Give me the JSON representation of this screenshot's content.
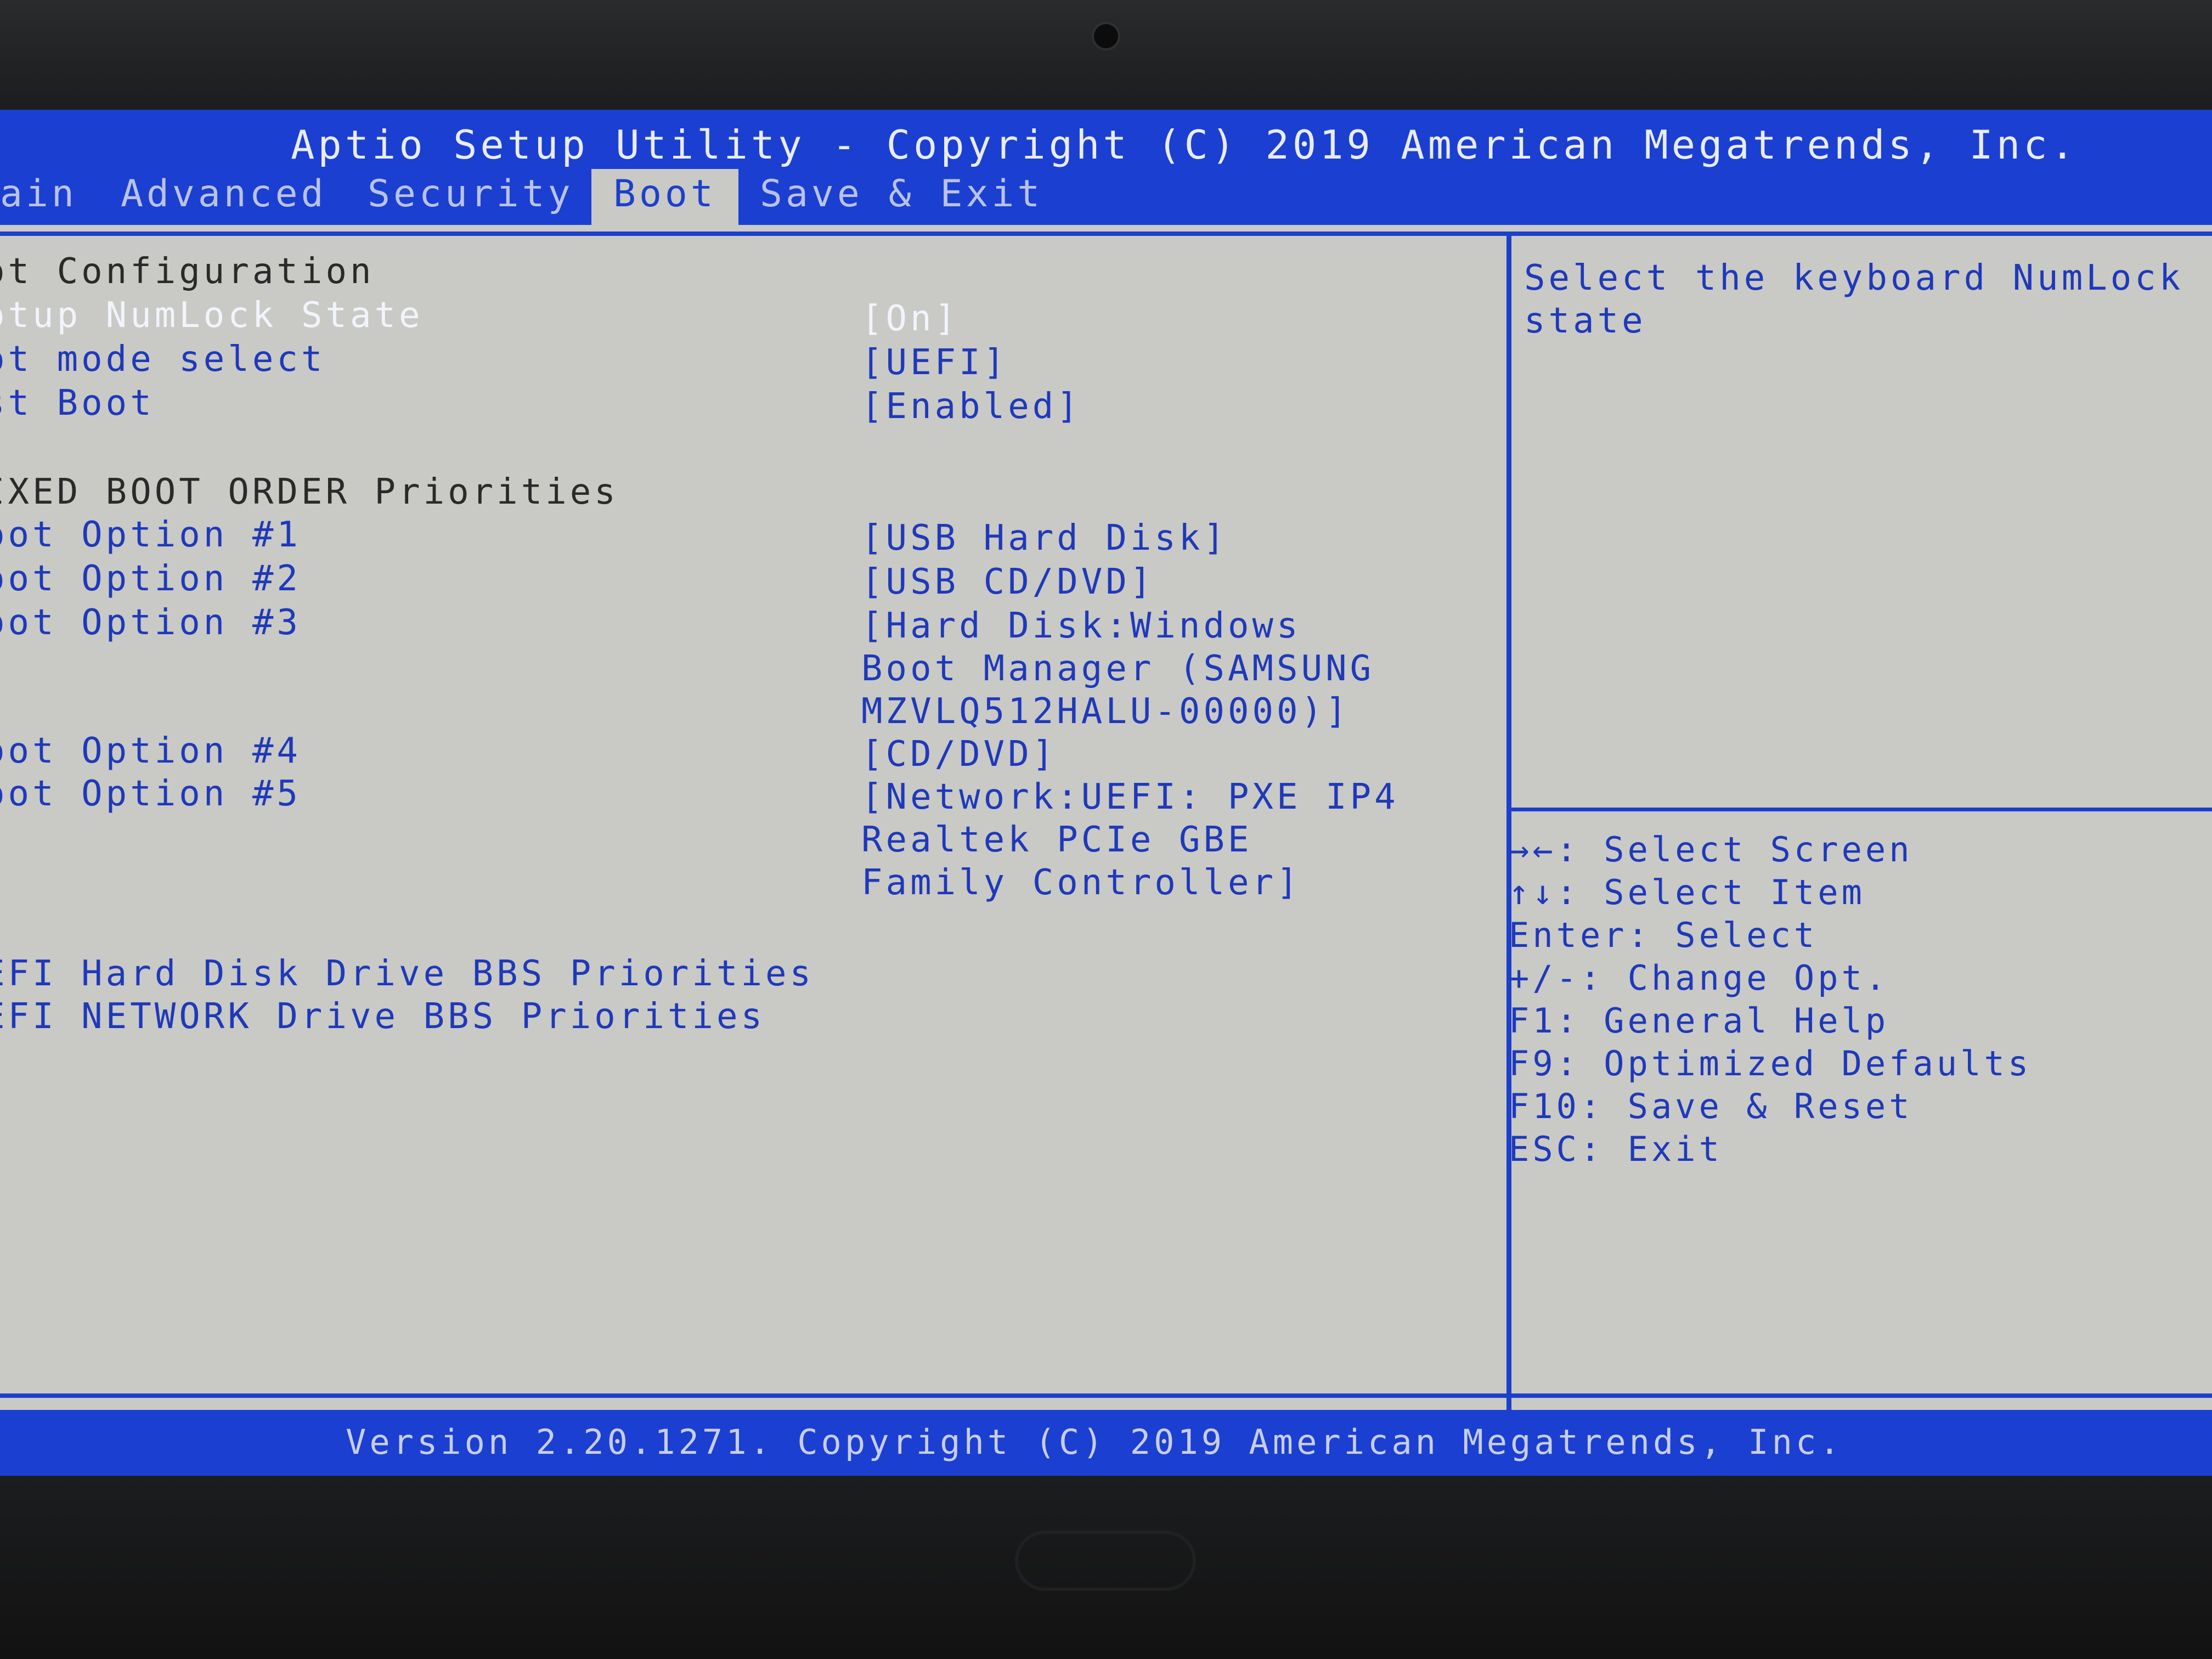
{
  "header": {
    "title": "Aptio Setup Utility - Copyright (C) 2019 American Megatrends, Inc."
  },
  "tabs": [
    {
      "label": "ain"
    },
    {
      "label": "Advanced"
    },
    {
      "label": "Security"
    },
    {
      "label": "Boot"
    },
    {
      "label": "Save & Exit"
    }
  ],
  "settings": {
    "boot_configuration": "ot Configuration",
    "numlock": {
      "label": "otup NumLock State",
      "value": "[On]"
    },
    "boot_mode": {
      "label": "ot mode select",
      "value": "[UEFI]"
    },
    "fast_boot": {
      "label": "st Boot",
      "value": "[Enabled]"
    },
    "fixed_boot_order": "IXED BOOT ORDER Priorities",
    "option1": {
      "label": "oot Option #1",
      "value": "[USB Hard Disk]"
    },
    "option2": {
      "label": "oot Option #2",
      "value": "[USB CD/DVD]"
    },
    "option3": {
      "label": "oot Option #3",
      "value": "[Hard Disk:Windows\nBoot Manager (SAMSUNG\nMZVLQ512HALU-00000)]"
    },
    "option4": {
      "label": "oot Option #4",
      "value": "[CD/DVD]"
    },
    "option5": {
      "label": "oot Option #5",
      "value": "[Network:UEFI: PXE IP4\nRealtek PCIe GBE\nFamily Controller]"
    },
    "uefi_hdd": "EFI Hard Disk Drive BBS Priorities",
    "uefi_network": "EFI NETWORK Drive BBS Priorities"
  },
  "help": {
    "description": "Select the keyboard NumLock state",
    "keys": [
      "→←: Select Screen",
      "↑↓: Select Item",
      "Enter: Select",
      "+/-: Change Opt.",
      "F1: General Help",
      "F9: Optimized Defaults",
      "F10: Save & Reset",
      "ESC: Exit"
    ]
  },
  "footer": {
    "version": "Version 2.20.1271. Copyright (C) 2019 American Megatrends, Inc."
  }
}
